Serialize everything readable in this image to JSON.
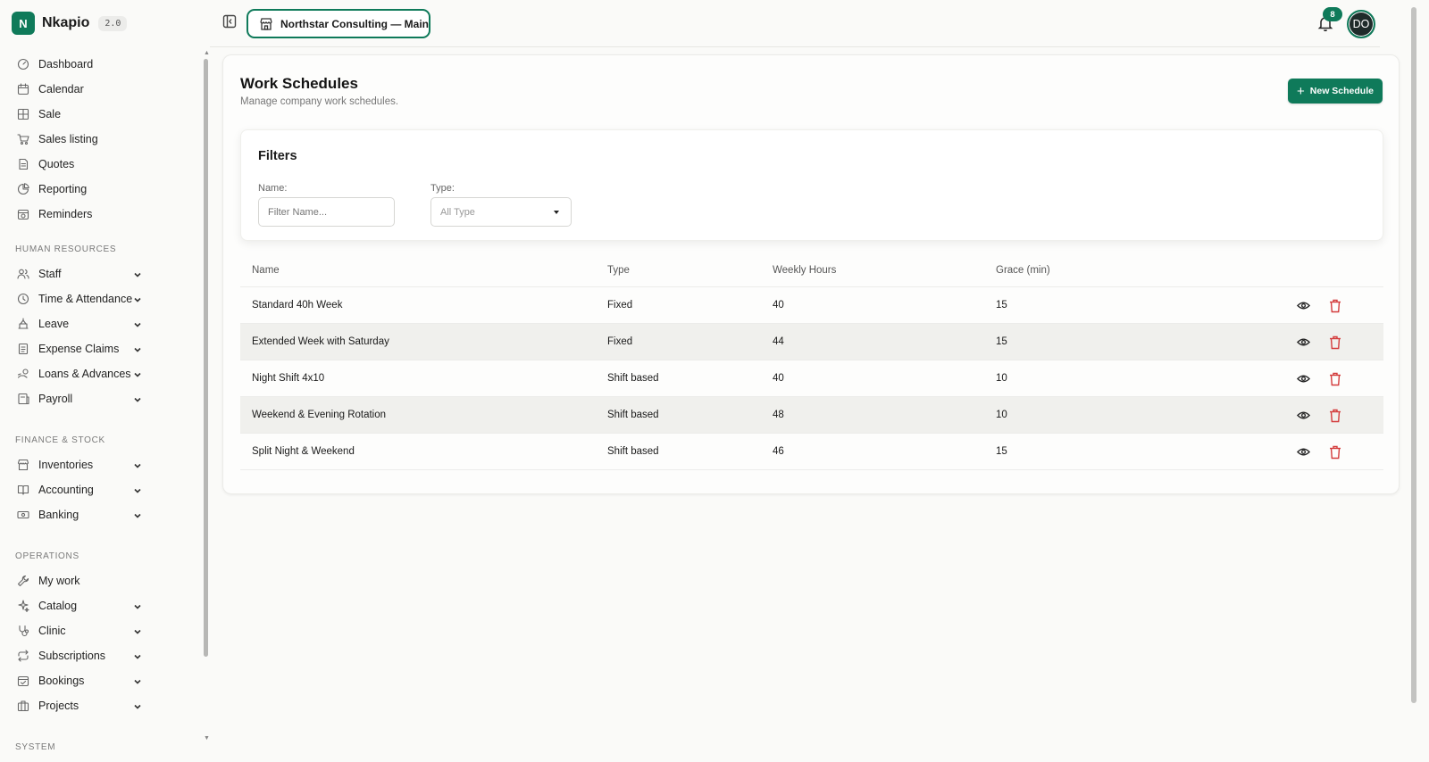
{
  "brand": {
    "logo_letter": "N",
    "name": "Nkapio",
    "version": "2.0"
  },
  "colors": {
    "accent": "#0f7a5a",
    "danger": "#d33b3b"
  },
  "nav": {
    "top_items": [
      {
        "label": "Dashboard",
        "icon": "dashboard-icon"
      },
      {
        "label": "Calendar",
        "icon": "calendar-icon"
      },
      {
        "label": "Sale",
        "icon": "grid-icon"
      },
      {
        "label": "Sales listing",
        "icon": "cart-icon"
      },
      {
        "label": "Quotes",
        "icon": "document-icon"
      },
      {
        "label": "Reporting",
        "icon": "pie-chart-icon"
      },
      {
        "label": "Reminders",
        "icon": "reminder-icon"
      }
    ],
    "sections": [
      {
        "title": "HUMAN RESOURCES",
        "items": [
          {
            "label": "Staff",
            "icon": "users-icon"
          },
          {
            "label": "Time & Attendance",
            "icon": "clock-icon"
          },
          {
            "label": "Leave",
            "icon": "leave-icon"
          },
          {
            "label": "Expense Claims",
            "icon": "receipt-icon"
          },
          {
            "label": "Loans & Advances",
            "icon": "loan-icon"
          },
          {
            "label": "Payroll",
            "icon": "payroll-icon"
          }
        ]
      },
      {
        "title": "FINANCE & STOCK",
        "items": [
          {
            "label": "Inventories",
            "icon": "store-icon"
          },
          {
            "label": "Accounting",
            "icon": "book-icon"
          },
          {
            "label": "Banking",
            "icon": "banknote-icon"
          }
        ]
      },
      {
        "title": "OPERATIONS",
        "items": [
          {
            "label": "My work",
            "icon": "wrench-icon"
          },
          {
            "label": "Catalog",
            "icon": "sparkle-icon"
          },
          {
            "label": "Clinic",
            "icon": "stethoscope-icon"
          },
          {
            "label": "Subscriptions",
            "icon": "repeat-icon"
          },
          {
            "label": "Bookings",
            "icon": "calendar-check-icon"
          },
          {
            "label": "Projects",
            "icon": "briefcase-icon"
          }
        ]
      }
    ],
    "system_title": "SYSTEM"
  },
  "topbar": {
    "org_label": "Northstar Consulting — Main",
    "notifications_count": "8",
    "avatar_initials": "DO"
  },
  "page": {
    "title": "Work Schedules",
    "subtitle": "Manage company work schedules.",
    "new_button": "New Schedule"
  },
  "filters": {
    "title": "Filters",
    "name_label": "Name:",
    "name_placeholder": "Filter Name...",
    "type_label": "Type:",
    "type_value": "All Type"
  },
  "table": {
    "headers": {
      "name": "Name",
      "type": "Type",
      "hours": "Weekly Hours",
      "grace": "Grace (min)"
    },
    "rows": [
      {
        "name": "Standard 40h Week",
        "type": "Fixed",
        "hours": "40",
        "grace": "15"
      },
      {
        "name": "Extended Week with Saturday",
        "type": "Fixed",
        "hours": "44",
        "grace": "15"
      },
      {
        "name": "Night Shift 4x10",
        "type": "Shift based",
        "hours": "40",
        "grace": "10"
      },
      {
        "name": "Weekend & Evening Rotation",
        "type": "Shift based",
        "hours": "48",
        "grace": "10"
      },
      {
        "name": "Split Night & Weekend",
        "type": "Shift based",
        "hours": "46",
        "grace": "15"
      }
    ]
  }
}
